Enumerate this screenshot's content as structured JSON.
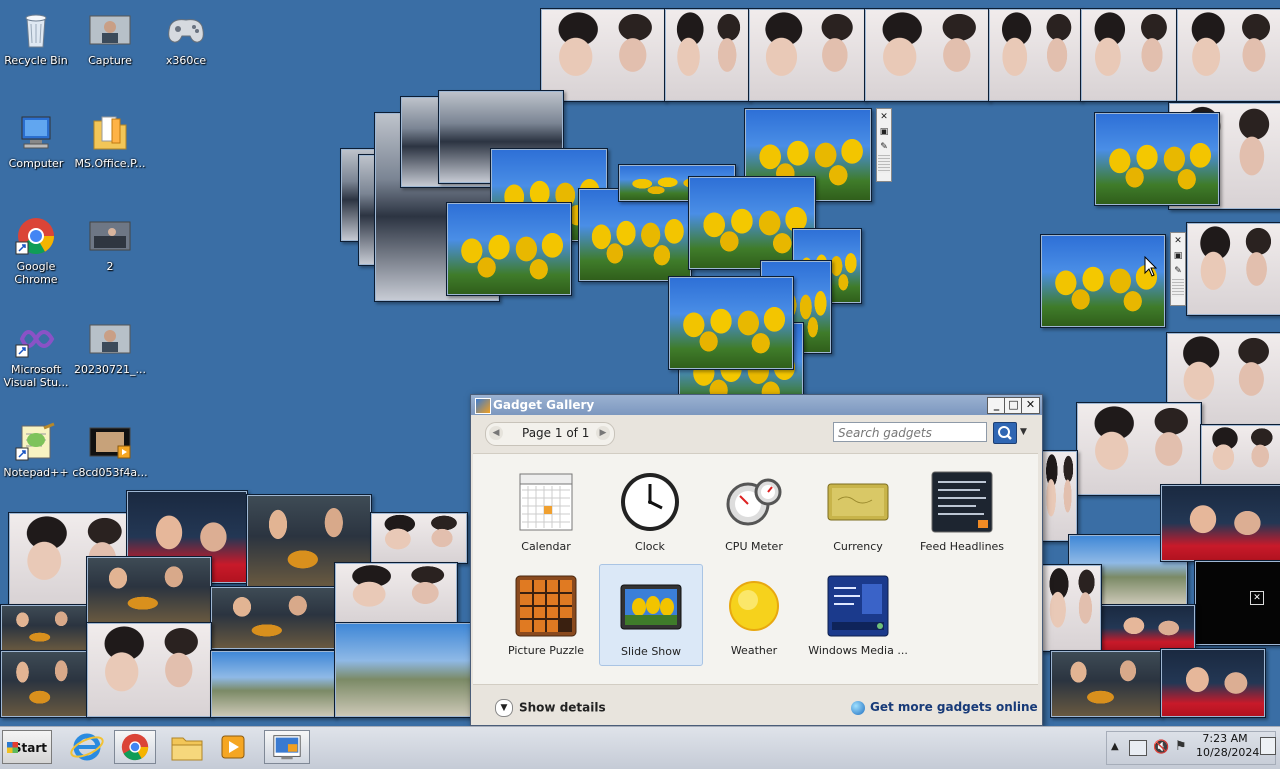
{
  "desktop": {
    "icons": [
      {
        "label": "Recycle Bin"
      },
      {
        "label": "Capture"
      },
      {
        "label": "x360ce"
      },
      {
        "label": "Computer"
      },
      {
        "label": "MS.Office.P..."
      },
      {
        "label": "Google Chrome"
      },
      {
        "label": "2"
      },
      {
        "label": "Microsoft Visual Stu..."
      },
      {
        "label": "20230721_..."
      },
      {
        "label": "Notepad++"
      },
      {
        "label": "c8cd053f4a..."
      }
    ]
  },
  "gadget_gallery": {
    "title": "Gadget Gallery",
    "page_label": "Page 1 of 1",
    "search_placeholder": "Search gadgets",
    "gadgets": [
      {
        "label": "Calendar",
        "icon": "calendar-icon"
      },
      {
        "label": "Clock",
        "icon": "clock-icon"
      },
      {
        "label": "CPU Meter",
        "icon": "cpu-meter-icon"
      },
      {
        "label": "Currency",
        "icon": "currency-icon"
      },
      {
        "label": "Feed Headlines",
        "icon": "feed-headlines-icon"
      },
      {
        "label": "Picture Puzzle",
        "icon": "picture-puzzle-icon"
      },
      {
        "label": "Slide Show",
        "icon": "slide-show-icon",
        "selected": true
      },
      {
        "label": "Weather",
        "icon": "weather-icon"
      },
      {
        "label": "Windows Media ...",
        "icon": "windows-media-icon"
      }
    ],
    "show_details": "Show details",
    "get_more": "Get more gadgets online"
  },
  "taskbar": {
    "start_label": "Start",
    "clock_time": "7:23 AM",
    "clock_date": "10/28/2024"
  },
  "colors": {
    "desktop": "#3a6ea5",
    "title_bar": "#7c97bf",
    "selection": "#dbe8f7"
  }
}
